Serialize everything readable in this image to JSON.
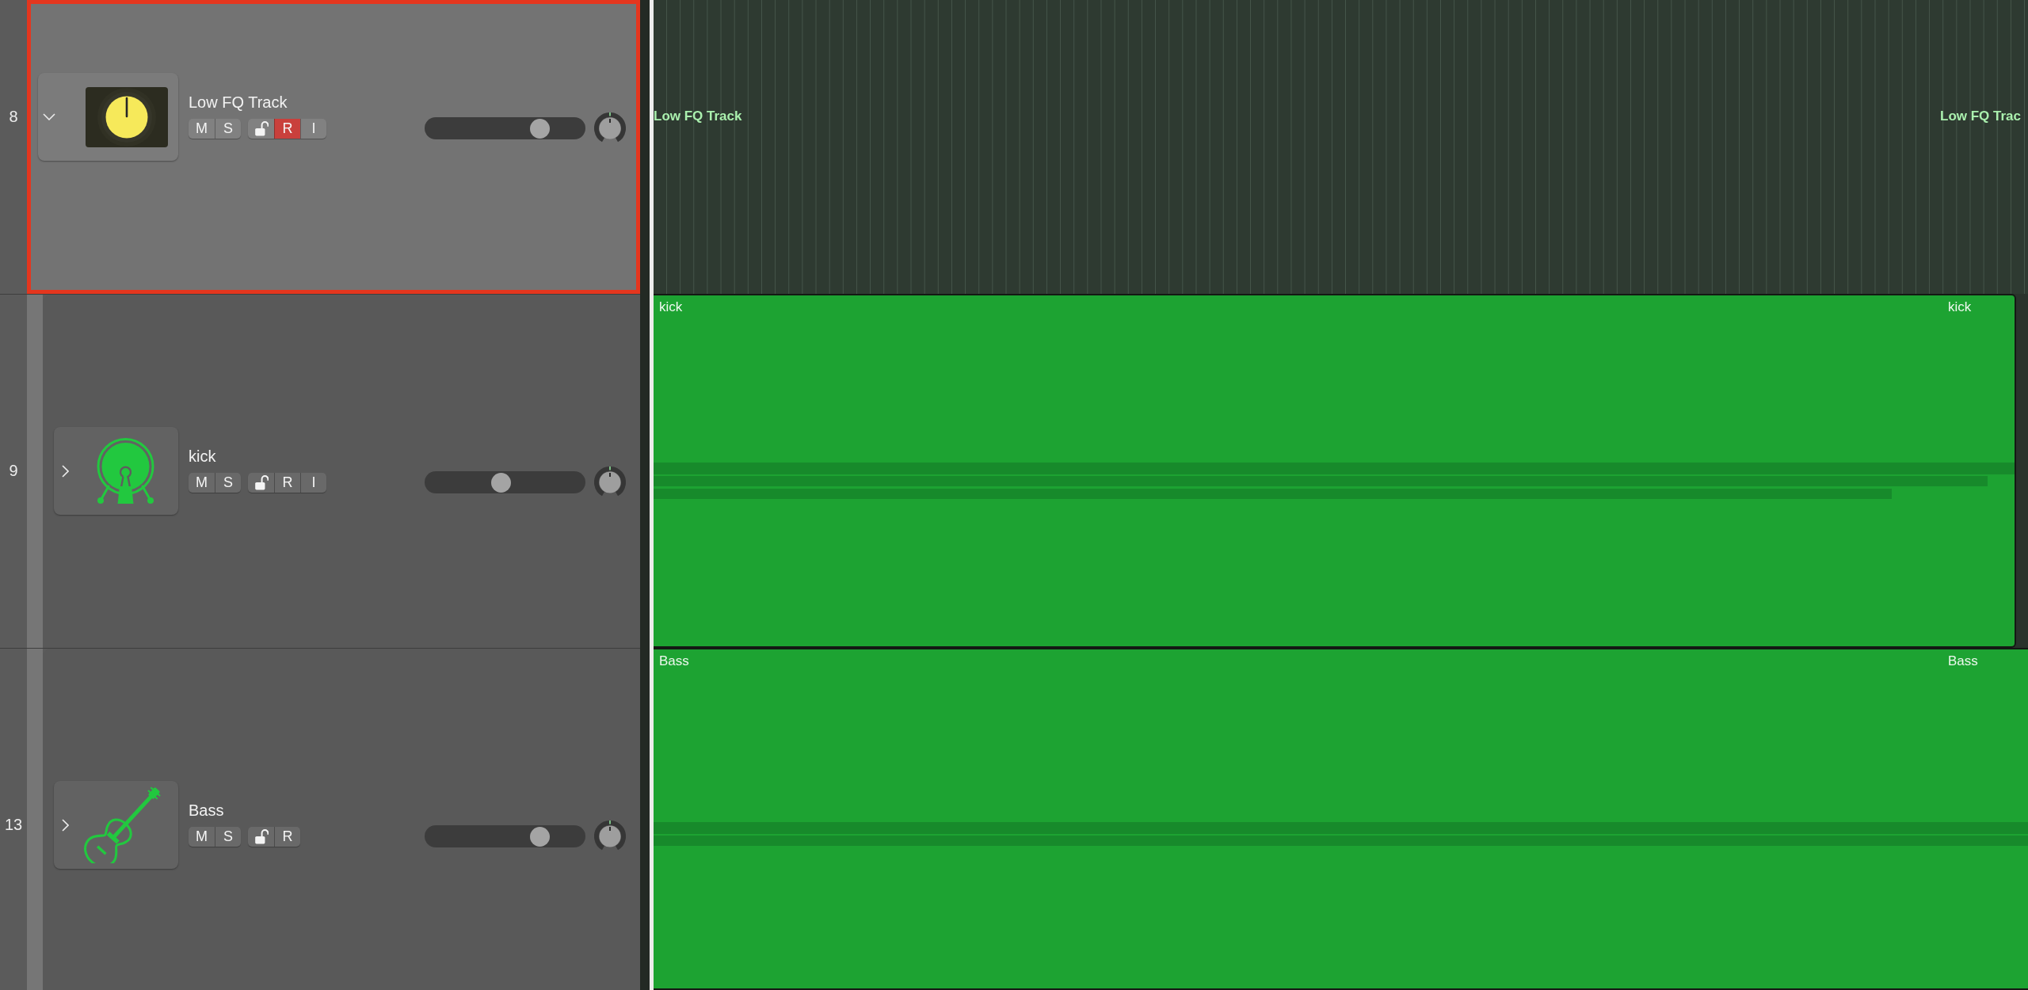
{
  "tracks": [
    {
      "number": "8",
      "name": "Low FQ Track",
      "kind": "stack",
      "selected": true,
      "expanded": true,
      "button_groups": [
        [
          {
            "kind": "mute",
            "label": "M",
            "on": false
          },
          {
            "kind": "solo",
            "label": "S",
            "on": false
          }
        ],
        [
          {
            "kind": "lock",
            "on": false
          },
          {
            "kind": "record",
            "label": "R",
            "on": true
          },
          {
            "kind": "input",
            "label": "I",
            "on": false
          }
        ]
      ],
      "volume": {
        "level": 0.75
      },
      "region": {
        "labels": [
          "Low FQ Track",
          "Low FQ Trac"
        ]
      },
      "children": [
        {
          "number": "9",
          "name": "kick",
          "kind": "drums",
          "selected": false,
          "expanded": false,
          "button_groups": [
            [
              {
                "kind": "mute",
                "label": "M",
                "on": false
              },
              {
                "kind": "solo",
                "label": "S",
                "on": false
              }
            ],
            [
              {
                "kind": "lock",
                "on": false
              },
              {
                "kind": "record",
                "label": "R",
                "on": false
              },
              {
                "kind": "input",
                "label": "I",
                "on": false
              }
            ]
          ],
          "volume": {
            "level": 0.47
          },
          "region": {
            "labels": [
              "kick",
              "kick"
            ]
          }
        },
        {
          "number": "13",
          "name": "Bass",
          "kind": "bass",
          "selected": false,
          "expanded": false,
          "button_groups": [
            [
              {
                "kind": "mute",
                "label": "M",
                "on": false
              },
              {
                "kind": "solo",
                "label": "S",
                "on": false
              }
            ],
            [
              {
                "kind": "lock",
                "on": false
              },
              {
                "kind": "record",
                "label": "R",
                "on": false
              }
            ]
          ],
          "volume": {
            "level": 0.75
          },
          "region": {
            "labels": [
              "Bass",
              "Bass"
            ]
          }
        }
      ]
    }
  ]
}
